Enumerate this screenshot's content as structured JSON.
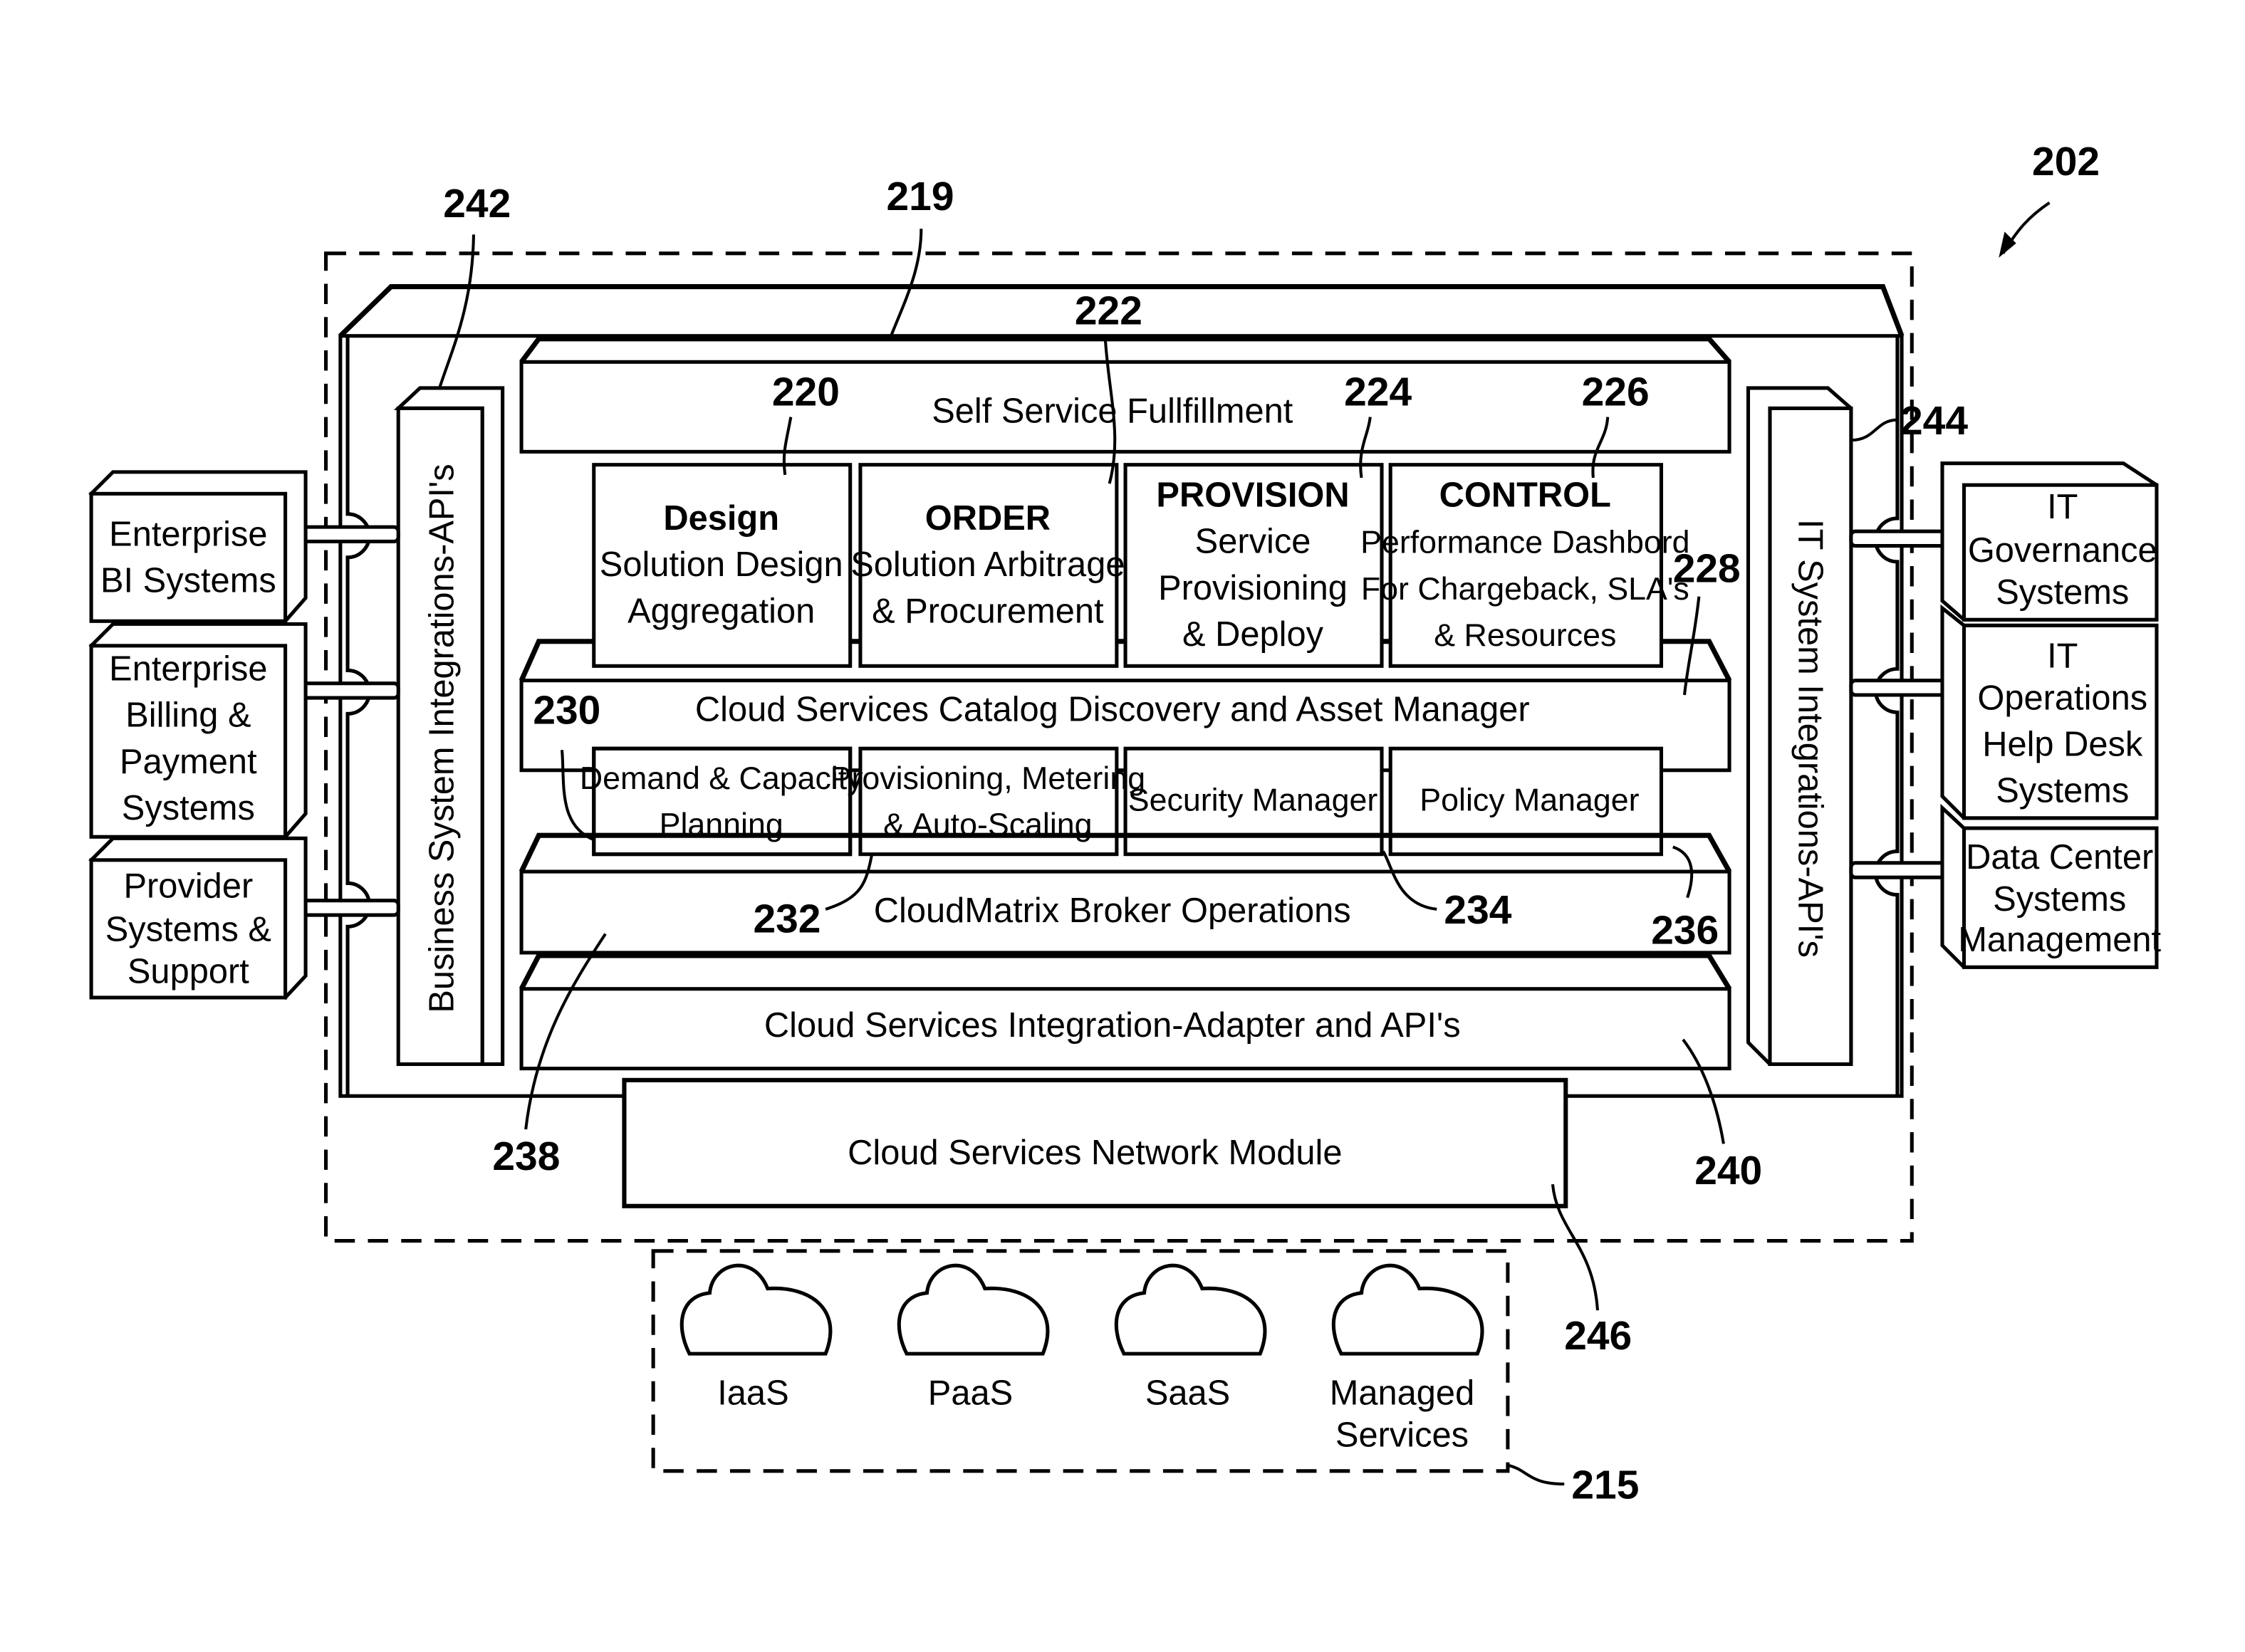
{
  "figure": {
    "ref_main": "202",
    "ref_cloud_group": "215",
    "ref_platform": "219"
  },
  "top_bar": {
    "label": "Self Service Fullfillment"
  },
  "modules": [
    {
      "ref": "220",
      "title": "Design",
      "lines": [
        "Solution Design",
        "Aggregation"
      ]
    },
    {
      "ref": "222",
      "title": "ORDER",
      "lines": [
        "Solution Arbitrage",
        "& Procurement"
      ]
    },
    {
      "ref": "224",
      "title": "PROVISION",
      "lines": [
        "Service",
        "Provisioning",
        "& Deploy"
      ]
    },
    {
      "ref": "226",
      "title": "CONTROL",
      "lines": [
        "Performance Dashbord",
        "For Chargeback, SLA's",
        "& Resources"
      ]
    }
  ],
  "catalog_bar": {
    "ref": "228",
    "label": "Cloud Services Catalog Discovery and Asset Manager"
  },
  "managers": [
    {
      "ref": "230",
      "lines": [
        "Demand & Capacity",
        "Planning"
      ]
    },
    {
      "ref": "232",
      "lines": [
        "Provisioning, Metering",
        "& Auto-Scaling"
      ]
    },
    {
      "ref": "234",
      "lines": [
        "Security Manager"
      ]
    },
    {
      "ref": "236",
      "lines": [
        "Policy Manager"
      ]
    }
  ],
  "broker_bar": {
    "ref": "238",
    "label": "CloudMatrix Broker Operations"
  },
  "integration_bar": {
    "ref": "240",
    "label": "Cloud Services Integration-Adapter and API's"
  },
  "left_column": {
    "ref": "242",
    "label": "Business System Integrations-API's"
  },
  "right_column": {
    "ref": "244",
    "label": "IT System Integrations-API's"
  },
  "network_module": {
    "ref": "246",
    "label": "Cloud Services Network Module"
  },
  "left_systems": [
    {
      "lines": [
        "Enterprise",
        "BI Systems"
      ]
    },
    {
      "lines": [
        "Enterprise",
        "Billing &",
        "Payment",
        "Systems"
      ]
    },
    {
      "lines": [
        "Provider",
        "Systems &",
        "Support"
      ]
    }
  ],
  "right_systems": [
    {
      "lines": [
        "IT",
        "Governance",
        "Systems"
      ]
    },
    {
      "lines": [
        "IT",
        "Operations",
        "Help Desk",
        "Systems"
      ]
    },
    {
      "lines": [
        "Data Center",
        "Systems",
        "Management"
      ]
    }
  ],
  "clouds": [
    {
      "lines": [
        "IaaS"
      ]
    },
    {
      "lines": [
        "PaaS"
      ]
    },
    {
      "lines": [
        "SaaS"
      ]
    },
    {
      "lines": [
        "Managed",
        "Services"
      ]
    }
  ]
}
